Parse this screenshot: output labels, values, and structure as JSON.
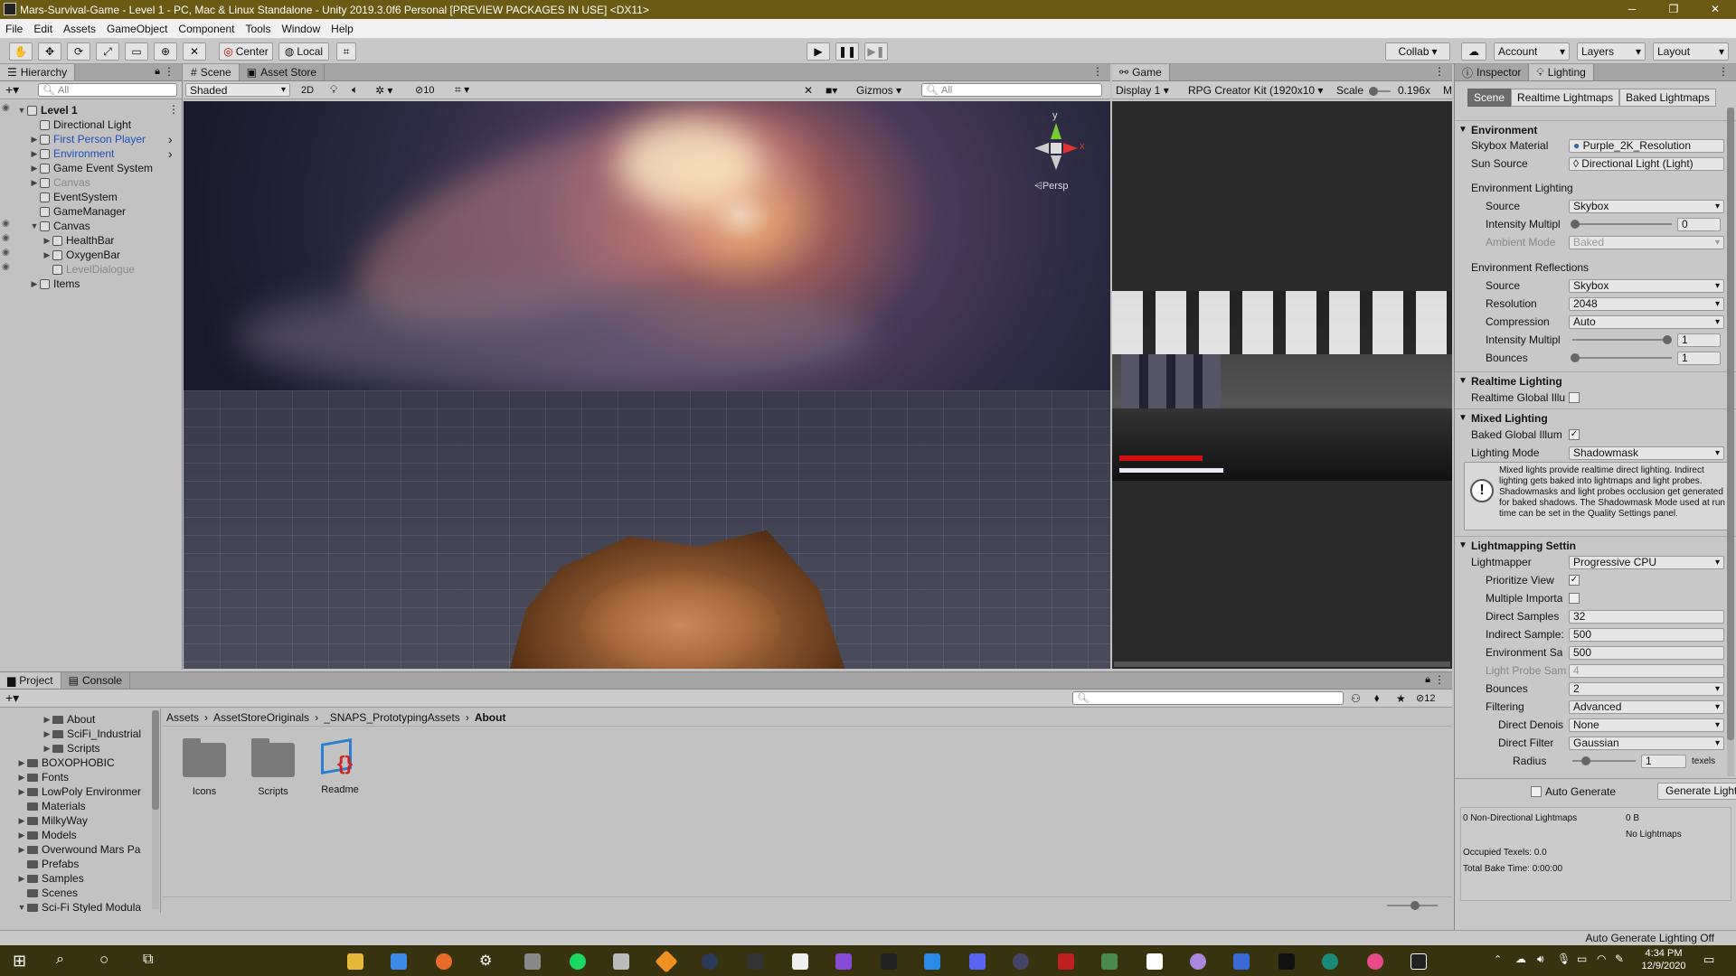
{
  "window": {
    "title": "Mars-Survival-Game - Level 1 - PC, Mac & Linux Standalone - Unity 2019.3.0f6 Personal [PREVIEW PACKAGES IN USE] <DX11>"
  },
  "menu": [
    "File",
    "Edit",
    "Assets",
    "GameObject",
    "Component",
    "Tools",
    "Window",
    "Help"
  ],
  "toolbar": {
    "center": "Center",
    "local": "Local",
    "collab": "Collab",
    "account": "Account",
    "layers": "Layers",
    "layout": "Layout"
  },
  "hierarchy": {
    "tab": "Hierarchy",
    "search_placeholder": "All",
    "items": [
      {
        "label": "Level 1",
        "depth": 0,
        "expanded": true,
        "style": "bold"
      },
      {
        "label": "Directional Light",
        "depth": 1
      },
      {
        "label": "First Person Player",
        "depth": 1,
        "style": "blue",
        "arrow": true
      },
      {
        "label": "Environment",
        "depth": 1,
        "style": "blue",
        "arrow": true
      },
      {
        "label": "Game Event System",
        "depth": 1,
        "arrow": true
      },
      {
        "label": "Canvas",
        "depth": 1,
        "style": "grey",
        "arrow": true
      },
      {
        "label": "EventSystem",
        "depth": 1
      },
      {
        "label": "GameManager",
        "depth": 1
      },
      {
        "label": "Canvas",
        "depth": 1,
        "expanded": true
      },
      {
        "label": "HealthBar",
        "depth": 2,
        "arrow": true
      },
      {
        "label": "OxygenBar",
        "depth": 2,
        "arrow": true
      },
      {
        "label": "LevelDialogue",
        "depth": 2,
        "style": "grey"
      },
      {
        "label": "Items",
        "depth": 1,
        "arrow": true
      }
    ]
  },
  "scene": {
    "tab": "Scene",
    "tab2": "Asset Store",
    "shading": "Shaded",
    "mode2d": "2D",
    "hidden_count": "10",
    "gizmos": "Gizmos",
    "search_placeholder": "All",
    "persp": "Persp",
    "axis_y": "y",
    "axis_x": "x"
  },
  "game": {
    "tab": "Game",
    "display": "Display 1",
    "resolution": "RPG Creator Kit (1920x10",
    "scale_label": "Scale",
    "scale_value": "0.196x",
    "trail": "M",
    "health": 0.8,
    "oxygen": 1.0
  },
  "inspector": {
    "tab1": "Inspector",
    "tab2": "Lighting",
    "subtabs": [
      "Scene",
      "Realtime Lightmaps",
      "Baked Lightmaps"
    ],
    "environment": {
      "header": "Environment",
      "skybox_label": "Skybox Material",
      "skybox_value": "Purple_2K_Resolution",
      "sun_label": "Sun Source",
      "sun_value": "Directional Light (Light)",
      "env_lighting": "Environment Lighting",
      "source_label": "Source",
      "source_value": "Skybox",
      "intensity_label": "Intensity Multipl",
      "intensity_value": "0",
      "ambient_label": "Ambient Mode",
      "ambient_value": "Baked",
      "env_reflections": "Environment Reflections",
      "ref_source_label": "Source",
      "ref_source_value": "Skybox",
      "resolution_label": "Resolution",
      "resolution_value": "2048",
      "compression_label": "Compression",
      "compression_value": "Auto",
      "ref_intensity_label": "Intensity Multipl",
      "ref_intensity_value": "1",
      "bounces_label": "Bounces",
      "bounces_value": "1"
    },
    "realtime": {
      "header": "Realtime Lighting",
      "gi_label": "Realtime Global Illu"
    },
    "mixed": {
      "header": "Mixed Lighting",
      "baked_label": "Baked Global Illum",
      "mode_label": "Lighting Mode",
      "mode_value": "Shadowmask",
      "info": "Mixed lights provide realtime direct lighting. Indirect lighting gets baked into lightmaps and light probes. Shadowmasks and light probes occlusion get generated for baked shadows. The Shadowmask Mode used at run time can be set in the Quality Settings panel."
    },
    "lightmapping": {
      "header": "Lightmapping Settin",
      "lightmapper_label": "Lightmapper",
      "lightmapper_value": "Progressive CPU",
      "prioritize_label": "Prioritize View",
      "multiple_label": "Multiple Importa",
      "direct_label": "Direct Samples",
      "direct_value": "32",
      "indirect_label": "Indirect Sample:",
      "indirect_value": "500",
      "envsamp_label": "Environment Sa",
      "envsamp_value": "500",
      "probe_label": "Light Probe Sam",
      "probe_value": "4",
      "bounces_label": "Bounces",
      "bounces_value": "2",
      "filtering_label": "Filtering",
      "filtering_value": "Advanced",
      "denoise_label": "Direct Denois",
      "denoise_value": "None",
      "filter_label": "Direct Filter",
      "filter_value": "Gaussian",
      "radius_label": "Radius",
      "radius_value": "1",
      "radius_unit": "texels"
    },
    "auto_generate": "Auto Generate",
    "generate_button": "Generate Lighti",
    "stats": {
      "non_dir": "0 Non-Directional Lightmaps",
      "size": "0 B",
      "no_lightmaps": "No Lightmaps",
      "occupied": "Occupied Texels: 0.0",
      "bake_time": "Total Bake Time: 0:00:00"
    }
  },
  "project": {
    "tab1": "Project",
    "tab2": "Console",
    "badge": "12",
    "tree": [
      {
        "label": "About",
        "depth": 2,
        "arrow": true
      },
      {
        "label": "SciFi_Industrial",
        "depth": 2,
        "arrow": true
      },
      {
        "label": "Scripts",
        "depth": 2,
        "arrow": true
      },
      {
        "label": "BOXOPHOBIC",
        "depth": 1,
        "arrow": true
      },
      {
        "label": "Fonts",
        "depth": 1,
        "arrow": true
      },
      {
        "label": "LowPoly Environmer",
        "depth": 1,
        "arrow": true
      },
      {
        "label": "Materials",
        "depth": 1
      },
      {
        "label": "MilkyWay",
        "depth": 1,
        "arrow": true
      },
      {
        "label": "Models",
        "depth": 1,
        "arrow": true
      },
      {
        "label": "Overwound Mars Pa",
        "depth": 1,
        "arrow": true
      },
      {
        "label": "Prefabs",
        "depth": 1
      },
      {
        "label": "Samples",
        "depth": 1,
        "arrow": true
      },
      {
        "label": "Scenes",
        "depth": 1
      },
      {
        "label": "Sci-Fi Styled Modula",
        "depth": 1,
        "expanded": true
      }
    ],
    "breadcrumb": [
      "Assets",
      "AssetStoreOriginals",
      "_SNAPS_PrototypingAssets",
      "About"
    ],
    "assets": [
      {
        "label": "Icons",
        "kind": "folder"
      },
      {
        "label": "Scripts",
        "kind": "folder"
      },
      {
        "label": "Readme",
        "kind": "readme"
      }
    ]
  },
  "status": {
    "text": "Auto Generate Lighting Off"
  },
  "taskbar": {
    "time": "4:34 PM",
    "date": "12/9/2020"
  }
}
